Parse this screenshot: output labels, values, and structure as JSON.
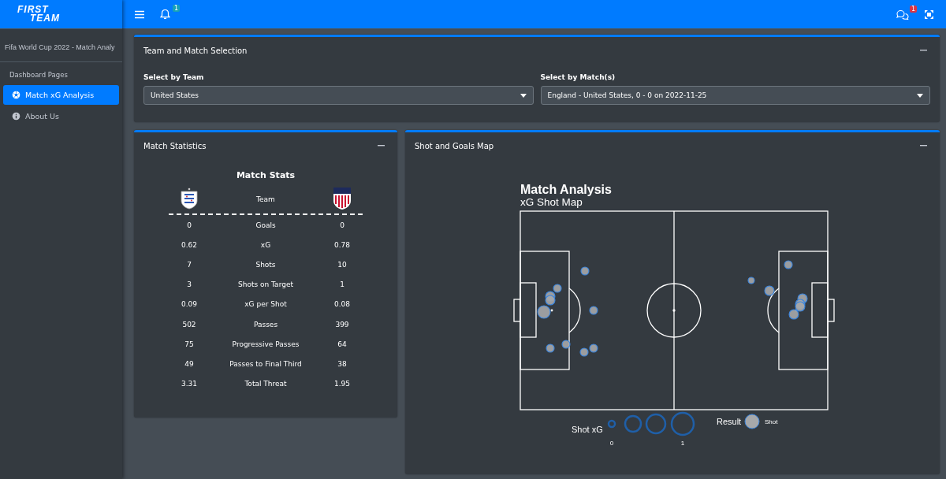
{
  "header": {
    "logo_lines": [
      "FIRST",
      "TEAM"
    ],
    "notifications_badge": "1",
    "messages_badge": "1"
  },
  "sidebar": {
    "title": "Fifa World Cup 2022 - Match Analy",
    "section": "Dashboard Pages",
    "items": [
      {
        "label": "Match xG Analysis",
        "kind": "soccer",
        "selected": true
      },
      {
        "label": "About Us",
        "kind": "info",
        "selected": false
      }
    ]
  },
  "selection_card": {
    "title": "Team and Match Selection",
    "fields": [
      {
        "label": "Select by Team",
        "value": "United States"
      },
      {
        "label": "Select by Match(s)",
        "value": "England - United States, 0 - 0 on 2022-11-25"
      }
    ]
  },
  "stats_card": {
    "title": "Match Statistics",
    "heading": "Match Stats",
    "header_label": "Team",
    "rows": [
      {
        "home": "0",
        "stat": "Goals",
        "away": "0"
      },
      {
        "home": "0.62",
        "stat": "xG",
        "away": "0.78"
      },
      {
        "home": "7",
        "stat": "Shots",
        "away": "10"
      },
      {
        "home": "3",
        "stat": "Shots on Target",
        "away": "1"
      },
      {
        "home": "0.09",
        "stat": "xG per Shot",
        "away": "0.08"
      },
      {
        "home": "502",
        "stat": "Passes",
        "away": "399"
      },
      {
        "home": "75",
        "stat": "Progressive Passes",
        "away": "64"
      },
      {
        "home": "49",
        "stat": "Passes to Final Third",
        "away": "38"
      },
      {
        "home": "3.31",
        "stat": "Total Threat",
        "away": "1.95"
      }
    ]
  },
  "map_card": {
    "title": "Shot and Goals Map",
    "chart_title": "Match Analysis",
    "chart_subtitle": "xG Shot Map",
    "legend": {
      "size_title": "Shot xG",
      "size_min": "0",
      "size_max": "1",
      "result_title": "Result",
      "result_label": "Shot"
    }
  }
}
